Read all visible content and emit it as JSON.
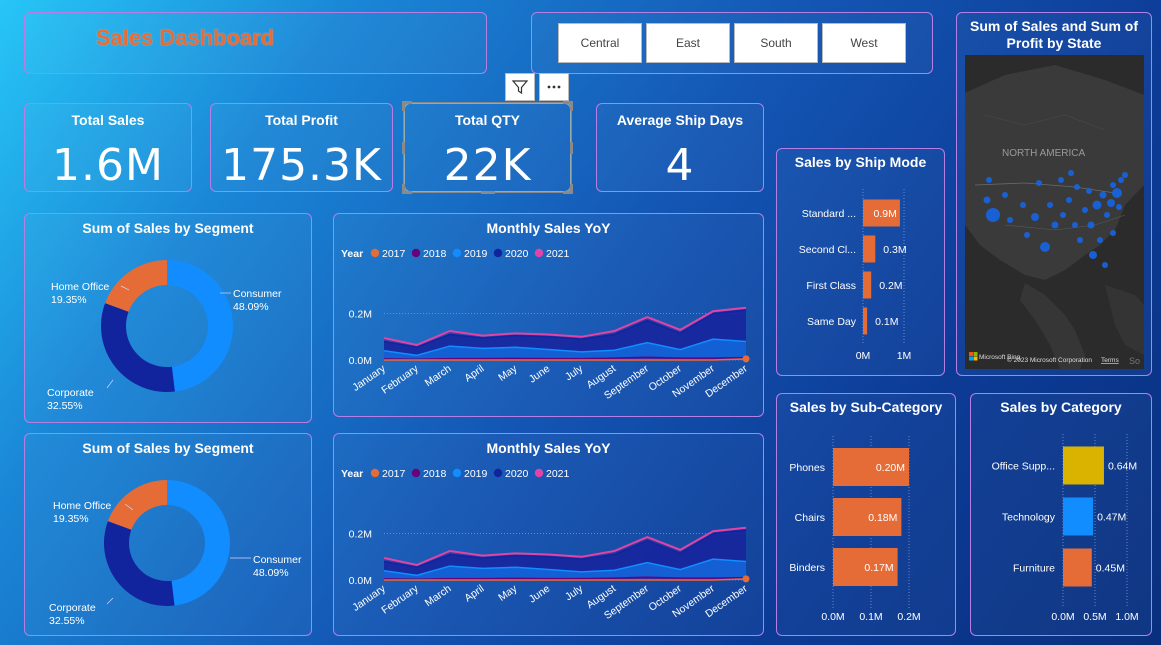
{
  "title": "Sales Dashboard",
  "slicer": [
    "Central",
    "East",
    "South",
    "West"
  ],
  "kpis": [
    {
      "label": "Total Sales",
      "value": "1.6M"
    },
    {
      "label": "Total Profit",
      "value": "175.3K"
    },
    {
      "label": "Total QTY",
      "value": "22K"
    },
    {
      "label": "Average Ship Days",
      "value": "4"
    }
  ],
  "map": {
    "title": "Sum of Sales and Sum of Profit by State",
    "region_label": "NORTH AMERICA",
    "attribution": "Microsoft Bing",
    "copyright": "© 2023 Microsoft Corporation",
    "terms": "Terms",
    "map_cut_text": "So"
  },
  "colors": {
    "orange": "#E66C37",
    "blue": "#118DFF",
    "navy": "#12239E",
    "purple": "#6B007B",
    "pink": "#E044A7",
    "yellow": "#D9B300"
  },
  "chart_data": [
    {
      "id": "segment-donut-1",
      "type": "pie",
      "title": "Sum of Sales by Segment",
      "slices": [
        {
          "label": "Consumer",
          "value": 48.09,
          "display": "48.09%",
          "color": "#118DFF"
        },
        {
          "label": "Corporate",
          "value": 32.55,
          "display": "32.55%",
          "color": "#12239E"
        },
        {
          "label": "Home Office",
          "value": 19.35,
          "display": "19.35%",
          "color": "#E66C37"
        }
      ]
    },
    {
      "id": "monthly-yoy-1",
      "type": "area",
      "title": "Monthly Sales YoY",
      "legend_title": "Year",
      "categories": [
        "January",
        "February",
        "March",
        "April",
        "May",
        "June",
        "July",
        "August",
        "September",
        "October",
        "November",
        "December"
      ],
      "yticks": [
        "0.0M",
        "0.2M"
      ],
      "ylim": [
        0,
        0.25
      ],
      "series": [
        {
          "name": "2017",
          "color": "#E66C37",
          "values": [
            0.0,
            0.0,
            0.0,
            0.0,
            0.0,
            0.0,
            0.0,
            0.0,
            0.0,
            0.0,
            0.0,
            0.005
          ]
        },
        {
          "name": "2018",
          "color": "#6B007B",
          "values": [
            0.005,
            0.003,
            0.006,
            0.006,
            0.007,
            0.006,
            0.006,
            0.008,
            0.012,
            0.008,
            0.008,
            0.01
          ]
        },
        {
          "name": "2019",
          "color": "#118DFF",
          "values": [
            0.04,
            0.02,
            0.06,
            0.05,
            0.055,
            0.045,
            0.035,
            0.042,
            0.075,
            0.045,
            0.09,
            0.08
          ]
        },
        {
          "name": "2020",
          "color": "#12239E",
          "values": [
            0.08,
            0.055,
            0.11,
            0.095,
            0.105,
            0.1,
            0.09,
            0.11,
            0.17,
            0.115,
            0.2,
            0.215
          ]
        },
        {
          "name": "2021",
          "color": "#E044A7",
          "values": [
            0.095,
            0.065,
            0.125,
            0.105,
            0.115,
            0.11,
            0.1,
            0.125,
            0.185,
            0.13,
            0.21,
            0.225
          ]
        }
      ]
    },
    {
      "id": "segment-donut-2",
      "type": "pie",
      "title": "Sum of Sales by Segment",
      "slices": [
        {
          "label": "Consumer",
          "value": 48.09,
          "display": "48.09%",
          "color": "#118DFF"
        },
        {
          "label": "Corporate",
          "value": 32.55,
          "display": "32.55%",
          "color": "#12239E"
        },
        {
          "label": "Home Office",
          "value": 19.35,
          "display": "19.35%",
          "color": "#E66C37"
        }
      ]
    },
    {
      "id": "monthly-yoy-2",
      "type": "area",
      "title": "Monthly Sales YoY",
      "legend_title": "Year",
      "categories": [
        "January",
        "February",
        "March",
        "April",
        "May",
        "June",
        "July",
        "August",
        "September",
        "October",
        "November",
        "December"
      ],
      "yticks": [
        "0.0M",
        "0.2M"
      ],
      "ylim": [
        0,
        0.25
      ],
      "series": [
        {
          "name": "2017",
          "color": "#E66C37",
          "values": [
            0.0,
            0.0,
            0.0,
            0.0,
            0.0,
            0.0,
            0.0,
            0.0,
            0.0,
            0.0,
            0.0,
            0.005
          ]
        },
        {
          "name": "2018",
          "color": "#6B007B",
          "values": [
            0.005,
            0.003,
            0.006,
            0.006,
            0.007,
            0.006,
            0.006,
            0.008,
            0.012,
            0.008,
            0.008,
            0.01
          ]
        },
        {
          "name": "2019",
          "color": "#118DFF",
          "values": [
            0.04,
            0.02,
            0.06,
            0.05,
            0.055,
            0.045,
            0.035,
            0.042,
            0.075,
            0.045,
            0.09,
            0.08
          ]
        },
        {
          "name": "2020",
          "color": "#12239E",
          "values": [
            0.08,
            0.055,
            0.11,
            0.095,
            0.105,
            0.1,
            0.09,
            0.11,
            0.17,
            0.115,
            0.2,
            0.215
          ]
        },
        {
          "name": "2021",
          "color": "#E044A7",
          "values": [
            0.095,
            0.065,
            0.125,
            0.105,
            0.115,
            0.11,
            0.1,
            0.125,
            0.185,
            0.13,
            0.21,
            0.225
          ]
        }
      ]
    },
    {
      "id": "ship-mode-bar",
      "type": "bar",
      "orientation": "horizontal",
      "title": "Sales by Ship Mode",
      "categories": [
        "Standard ...",
        "Second Cl...",
        "First Class",
        "Same Day"
      ],
      "values": [
        0.9,
        0.3,
        0.2,
        0.1
      ],
      "labels": [
        "0.9M",
        "0.3M",
        "0.2M",
        "0.1M"
      ],
      "xticks": [
        "0M",
        "1M"
      ],
      "xlim": [
        0,
        1
      ],
      "color": "#E66C37"
    },
    {
      "id": "sub-category-bar",
      "type": "bar",
      "orientation": "horizontal",
      "title": "Sales by Sub-Category",
      "categories": [
        "Phones",
        "Chairs",
        "Binders"
      ],
      "values": [
        0.2,
        0.18,
        0.17
      ],
      "labels": [
        "0.20M",
        "0.18M",
        "0.17M"
      ],
      "xticks": [
        "0.0M",
        "0.1M",
        "0.2M"
      ],
      "xlim": [
        0,
        0.2
      ],
      "color": "#E66C37"
    },
    {
      "id": "category-bar",
      "type": "bar",
      "orientation": "horizontal",
      "title": "Sales by Category",
      "categories": [
        "Office Supp...",
        "Technology",
        "Furniture"
      ],
      "values": [
        0.64,
        0.47,
        0.45
      ],
      "labels": [
        "0.64M",
        "0.47M",
        "0.45M"
      ],
      "colors": [
        "#D9B300",
        "#118DFF",
        "#E66C37"
      ],
      "xticks": [
        "0.0M",
        "0.5M",
        "1.0M"
      ],
      "xlim": [
        0,
        1.0
      ]
    }
  ]
}
